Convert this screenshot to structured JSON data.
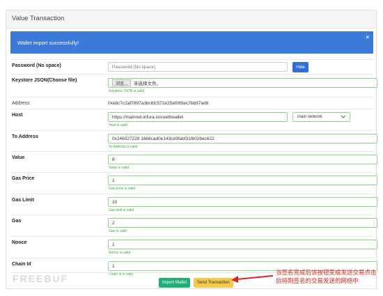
{
  "panel": {
    "title": "Value Transaction"
  },
  "alert": {
    "message": "Wallet import successfully!",
    "close": "×"
  },
  "password": {
    "label": "Password (No space)",
    "placeholder": "Password (No space)",
    "hide_button": "Hide"
  },
  "keystore": {
    "label": "Keystore JSON(Choose file)",
    "choose_button": "浏览...",
    "no_file_text": "未选择文件。",
    "hint": "Keystore JSON is valid"
  },
  "address": {
    "label": "Address",
    "value": "0xebc7c2af7897a3bc6fc572e25af065ec7bb97ad8"
  },
  "host": {
    "label": "Host",
    "value": "https://mainnet.infura.io/vuethwallet",
    "hint": "Host is valid",
    "network": "main network"
  },
  "to_address": {
    "label": "To Address",
    "value": "0x246027228 16b6cad0e143ce9fabf31f6026ec622",
    "hint": "To Address is valid"
  },
  "value": {
    "label": "Value",
    "value": "8",
    "hint": "Value is valid"
  },
  "gas_price": {
    "label": "Gas Price",
    "value": "1",
    "hint": "Gas price is valid"
  },
  "gas_limit": {
    "label": "Gas Limit",
    "value": "10",
    "hint": "Gas limit is valid"
  },
  "gas": {
    "label": "Gas",
    "value": "2",
    "hint": "Gas is valid"
  },
  "nonce": {
    "label": "Nonce",
    "value": "1",
    "hint": "Nonce is valid"
  },
  "chain_id": {
    "label": "Chain Id",
    "value": "1",
    "hint": "Chain id is valid"
  },
  "footer": {
    "import_button": "Import Wallet",
    "send_button": "Send Transaction"
  },
  "watermark": "FREEBUF",
  "annotation": "当签名完成后该按钮变成发送交易点击后将刚签名的交易发送的网络中",
  "colors": {
    "alert": "#3c7ad9",
    "valid": "#3aa83a",
    "import": "#1fae7a",
    "send": "#f7c948",
    "annotation": "#e02020"
  }
}
